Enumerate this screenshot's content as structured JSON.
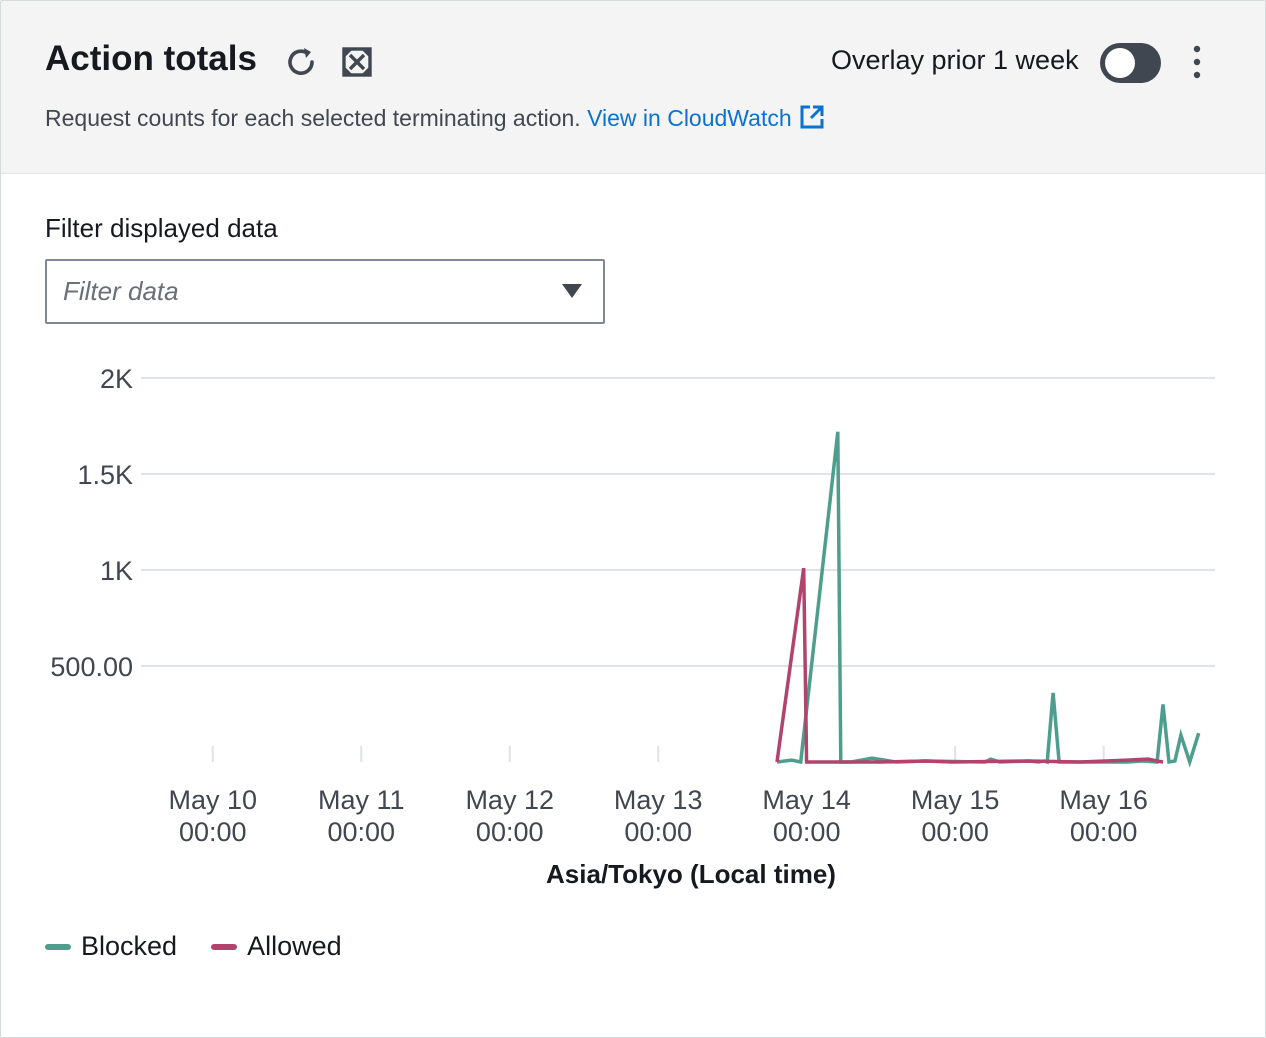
{
  "header": {
    "title": "Action totals",
    "refresh_icon": "refresh-icon",
    "fullscreen_icon": "fullscreen-icon",
    "overlay_label": "Overlay prior 1 week",
    "overlay_enabled": false,
    "more_icon": "more-vertical-icon",
    "description": "Request counts for each selected terminating action.",
    "link_text": "View in CloudWatch",
    "external_icon": "external-link-icon"
  },
  "filter": {
    "label": "Filter displayed data",
    "placeholder": "Filter data"
  },
  "colors": {
    "blocked": "#4e9e8e",
    "allowed": "#b1436d",
    "grid": "#dfe3e6",
    "text": "#414750"
  },
  "chart_data": {
    "type": "line",
    "title": "",
    "xlabel": "Asia/Tokyo (Local time)",
    "ylabel": "",
    "x_range": [
      "2024-05-09 12:24",
      "2024-05-16 18:00"
    ],
    "ylim": [
      0,
      2000
    ],
    "y_ticks": [
      {
        "value": 2000,
        "label": "2K"
      },
      {
        "value": 1500,
        "label": "1.5K"
      },
      {
        "value": 1000,
        "label": "1K"
      },
      {
        "value": 500,
        "label": "500.00"
      }
    ],
    "x_ticks": [
      {
        "value": "2024-05-10 00:00",
        "line1": "May 10",
        "line2": "00:00"
      },
      {
        "value": "2024-05-11 00:00",
        "line1": "May 11",
        "line2": "00:00"
      },
      {
        "value": "2024-05-12 00:00",
        "line1": "May 12",
        "line2": "00:00"
      },
      {
        "value": "2024-05-13 00:00",
        "line1": "May 13",
        "line2": "00:00"
      },
      {
        "value": "2024-05-14 00:00",
        "line1": "May 14",
        "line2": "00:00"
      },
      {
        "value": "2024-05-15 00:00",
        "line1": "May 15",
        "line2": "00:00"
      },
      {
        "value": "2024-05-16 00:00",
        "line1": "May 16",
        "line2": "00:00"
      }
    ],
    "grid": true,
    "legend_position": "bottom-left",
    "series": [
      {
        "name": "Blocked",
        "color": "#4e9e8e",
        "points": [
          [
            "2024-05-13 19:12",
            0
          ],
          [
            "2024-05-13 21:36",
            10
          ],
          [
            "2024-05-13 23:02",
            0
          ],
          [
            "2024-05-14 05:02",
            1720
          ],
          [
            "2024-05-14 05:31",
            0
          ],
          [
            "2024-05-14 07:12",
            0
          ],
          [
            "2024-05-14 10:34",
            20
          ],
          [
            "2024-05-14 14:24",
            0
          ],
          [
            "2024-05-14 19:12",
            5
          ],
          [
            "2024-05-15 04:48",
            0
          ],
          [
            "2024-05-15 05:46",
            15
          ],
          [
            "2024-05-15 07:12",
            0
          ],
          [
            "2024-05-15 12:00",
            5
          ],
          [
            "2024-05-15 13:26",
            0
          ],
          [
            "2024-05-15 14:24",
            5
          ],
          [
            "2024-05-15 14:53",
            0
          ],
          [
            "2024-05-15 15:50",
            360
          ],
          [
            "2024-05-15 16:48",
            0
          ],
          [
            "2024-05-16 03:50",
            0
          ],
          [
            "2024-05-16 06:14",
            5
          ],
          [
            "2024-05-16 08:38",
            0
          ],
          [
            "2024-05-16 09:36",
            300
          ],
          [
            "2024-05-16 10:34",
            0
          ],
          [
            "2024-05-16 11:31",
            5
          ],
          [
            "2024-05-16 12:29",
            140
          ],
          [
            "2024-05-16 13:55",
            0
          ],
          [
            "2024-05-16 15:22",
            150
          ]
        ]
      },
      {
        "name": "Allowed",
        "color": "#b1436d",
        "points": [
          [
            "2024-05-13 19:12",
            0
          ],
          [
            "2024-05-13 23:31",
            1010
          ],
          [
            "2024-05-13 23:59",
            0
          ],
          [
            "2024-05-14 12:00",
            0
          ],
          [
            "2024-05-14 19:12",
            5
          ],
          [
            "2024-05-14 23:31",
            0
          ],
          [
            "2024-05-15 12:00",
            5
          ],
          [
            "2024-05-15 20:10",
            0
          ],
          [
            "2024-05-16 03:50",
            10
          ],
          [
            "2024-05-16 07:12",
            15
          ],
          [
            "2024-05-16 08:38",
            5
          ],
          [
            "2024-05-16 09:36",
            0
          ]
        ]
      }
    ]
  }
}
